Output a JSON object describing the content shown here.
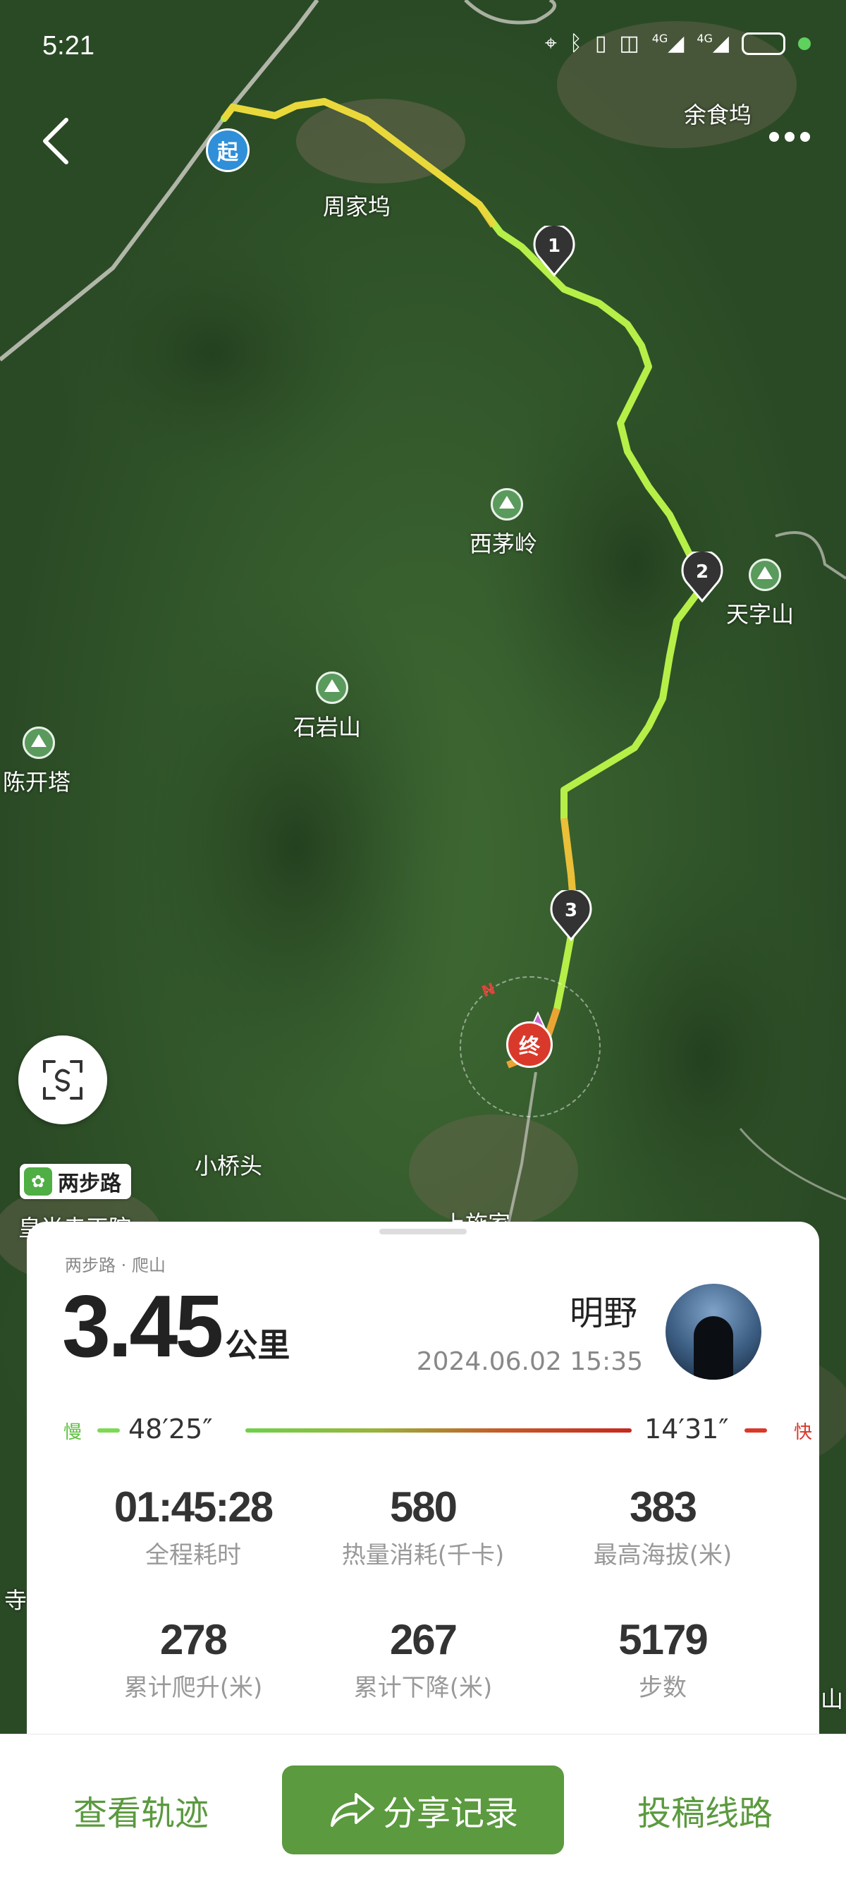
{
  "status_bar": {
    "time": "5:21",
    "signal_1": "4G",
    "signal_2": "4G"
  },
  "map": {
    "labels": {
      "yushiwu": "余食坞",
      "zhoujiawu": "周家坞",
      "ximaoling": "西茅岭",
      "tianzishan": "天字山",
      "shiyanshan": "石岩山",
      "chenkaita": "陈开塔",
      "xiaoqiaotou": "小桥头",
      "huangshangsi": "皇尚寺正院",
      "shangshijia": "上施家",
      "si": "寺",
      "shan": "山"
    },
    "start_marker": "起",
    "end_marker": "终",
    "checkpoints": [
      "1",
      "2",
      "3"
    ],
    "compass": "N",
    "brand_tag": "两步路"
  },
  "card": {
    "breadcrumb": "两步路 · 爬山",
    "distance_value": "3.45",
    "distance_unit": "公里",
    "user_name": "明野",
    "date": "2024.06.02 15:35",
    "pace": {
      "slow_label": "慢",
      "slow_value": "48′25″",
      "fast_value": "14′31″",
      "fast_label": "快"
    },
    "stats": [
      {
        "value": "01:45:28",
        "label": "全程耗时"
      },
      {
        "value": "580",
        "label": "热量消耗(千卡)"
      },
      {
        "value": "383",
        "label": "最高海拔(米)"
      },
      {
        "value": "278",
        "label": "累计爬升(米)"
      },
      {
        "value": "267",
        "label": "累计下降(米)"
      },
      {
        "value": "5179",
        "label": "步数"
      }
    ]
  },
  "bottom_bar": {
    "view_track": "查看轨迹",
    "share": "分享记录",
    "submit_route": "投稿线路"
  },
  "colors": {
    "accent": "#5b9a3f",
    "slow": "#6fd14a",
    "fast": "#c7281f"
  }
}
